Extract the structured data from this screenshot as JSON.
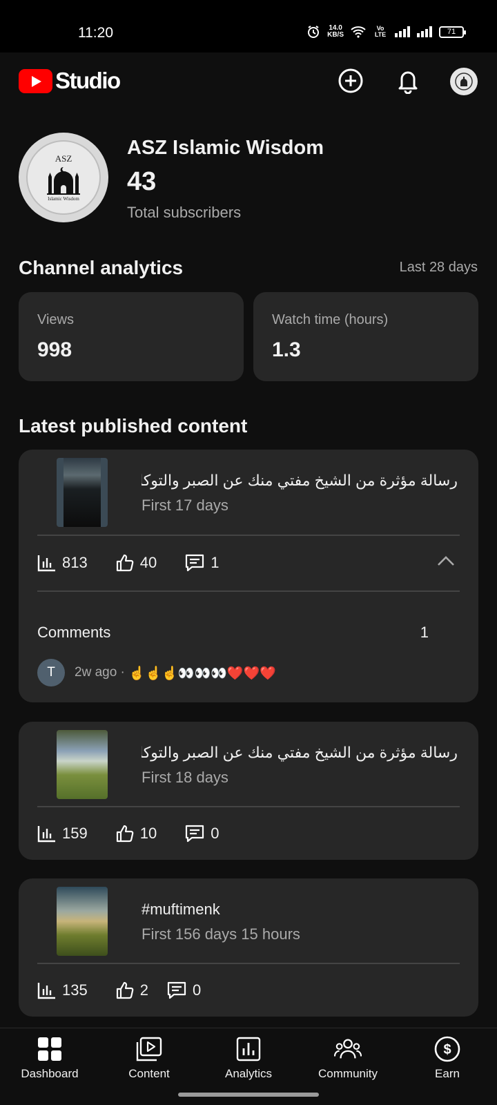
{
  "status_bar": {
    "time": "11:20",
    "net_speed_value": "14.0",
    "net_speed_unit": "KB/S",
    "volte": "Vo LTE",
    "battery": "71"
  },
  "header": {
    "app_name": "Studio",
    "create_icon": "add-circle-icon",
    "notifications_icon": "bell-icon"
  },
  "channel": {
    "name": "ASZ Islamic Wisdom",
    "subscribers": "43",
    "subscribers_label": "Total subscribers",
    "logo_text": "ASZ",
    "logo_subtext": "Islamic Wisdom"
  },
  "analytics": {
    "title": "Channel analytics",
    "period": "Last 28 days",
    "metrics": [
      {
        "label": "Views",
        "value": "998"
      },
      {
        "label": "Watch time (hours)",
        "value": "1.3"
      }
    ]
  },
  "latest": {
    "title": "Latest published content",
    "items": [
      {
        "title": "رسالة مؤثرة من الشيخ مفتي منك عن الصبر والتوكل...",
        "subtitle": "First 17 days",
        "views": "813",
        "likes": "40",
        "comments": "1",
        "comments_label": "Comments",
        "comments_count": "1",
        "comment": {
          "avatar": "T",
          "time": "2w ago ·",
          "text": "☝️☝️☝️👀👀👀❤️❤️❤️"
        }
      },
      {
        "title": "رسالة مؤثرة من الشيخ مفتي منك عن الصبر والتوكل...",
        "subtitle": "First 18 days",
        "views": "159",
        "likes": "10",
        "comments": "0"
      },
      {
        "title": "#muftimenk",
        "subtitle": "First 156 days 15 hours",
        "views": "135",
        "likes": "2",
        "comments": "0"
      }
    ]
  },
  "bottom_nav": {
    "items": [
      {
        "label": "Dashboard",
        "icon": "dashboard-icon"
      },
      {
        "label": "Content",
        "icon": "content-icon"
      },
      {
        "label": "Analytics",
        "icon": "analytics-icon"
      },
      {
        "label": "Community",
        "icon": "community-icon"
      },
      {
        "label": "Earn",
        "icon": "earn-icon"
      }
    ]
  },
  "colors": {
    "background": "#0f0f0f",
    "card": "#272727",
    "brand_red": "#ff0000",
    "secondary_text": "#aaaaaa"
  }
}
